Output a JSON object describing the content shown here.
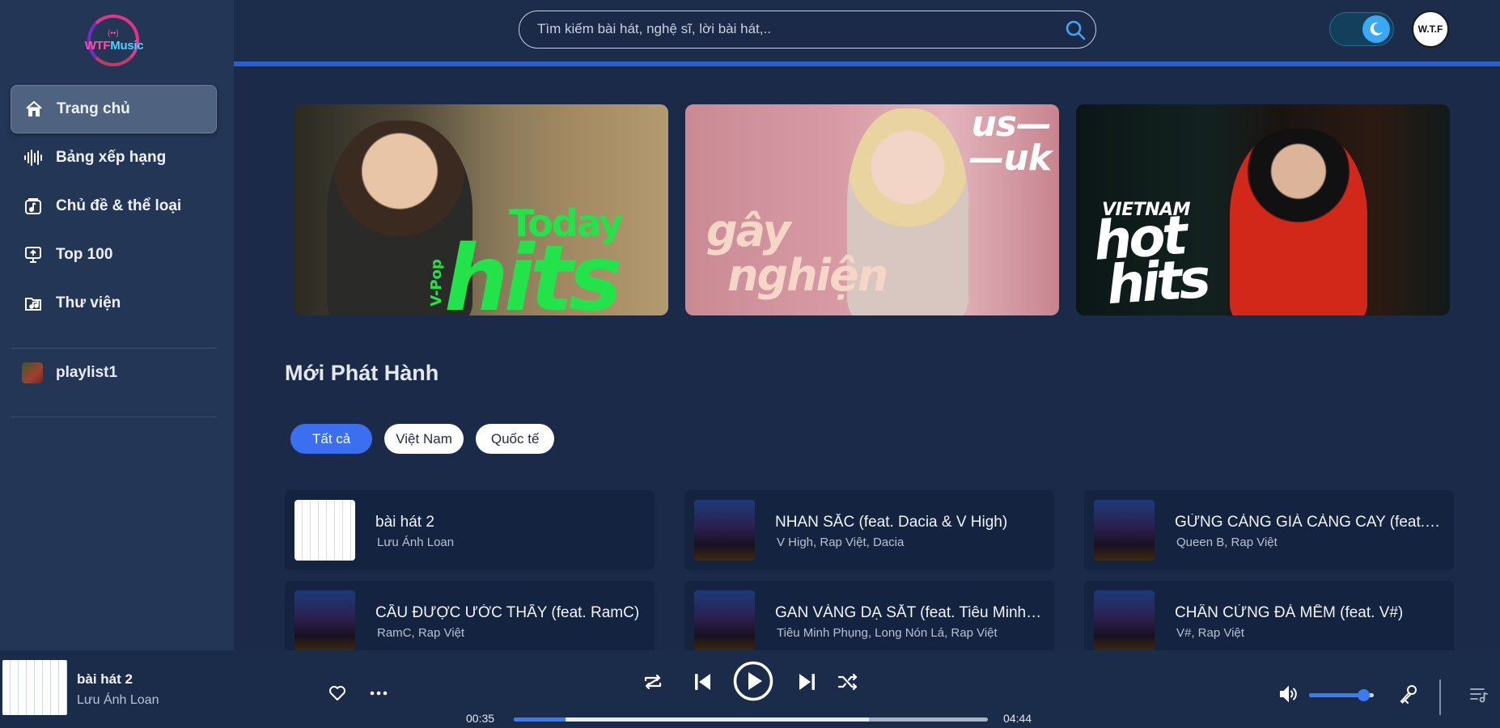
{
  "app": {
    "logo_part1": "WTF",
    "logo_part2": "Music"
  },
  "sidebar": {
    "items": [
      {
        "label": "Trang chủ",
        "icon": "home-icon",
        "active": true
      },
      {
        "label": "Bảng xếp hạng",
        "icon": "waveform-icon"
      },
      {
        "label": "Chủ đề & thể loại",
        "icon": "music-note-box-icon"
      },
      {
        "label": "Top 100",
        "icon": "podium-icon"
      },
      {
        "label": "Thư viện",
        "icon": "music-folder-icon"
      }
    ],
    "playlist": {
      "label": "playlist1"
    }
  },
  "header": {
    "search_placeholder": "Tìm kiếm bài hát, nghệ sĩ, lời bài hát,..",
    "avatar_text": "W.T.F"
  },
  "banners": [
    {
      "v_pop": "V-Pop",
      "today": "Today",
      "hits": "hits"
    },
    {
      "us": "us—",
      "uk": "—uk",
      "line1": "gây",
      "line2": "nghiện"
    },
    {
      "vietnam": "VIETNAM",
      "hot": "hot",
      "hits": "hits"
    }
  ],
  "section": {
    "title": "Mới Phát Hành",
    "filters": [
      "Tất cả",
      "Việt Nam",
      "Quốc tế"
    ]
  },
  "songs": [
    {
      "title": "bài hát 2",
      "artist": "Lưu Ánh Loan"
    },
    {
      "title": "NHAN SẮC (feat. Dacia & V High)",
      "artist": "V High, Rap Việt, Dacia"
    },
    {
      "title": "GỪNG CÀNG GIÀ CÀNG CAY (feat. ...",
      "artist": "Queen B, Rap Việt"
    },
    {
      "title": "CẦU ĐƯỢC ƯỚC THẤY (feat. RamC)",
      "artist": "RamC, Rap Việt"
    },
    {
      "title": "GAN VÀNG DẠ SẮT (feat. Tiêu Minh Phụng)",
      "artist": "Tiêu Minh Phụng, Long Nón Lá, Rap Việt"
    },
    {
      "title": "CHÂN CỨNG ĐÁ MỀM (feat. V#)",
      "artist": "V#, Rap Việt"
    }
  ],
  "player": {
    "title": "bài hát 2",
    "artist": "Lưu Ánh Loan",
    "current_time": "00:35",
    "total_time": "04:44",
    "progress": 0.11,
    "buffered": 0.75,
    "volume": 0.8,
    "accent_color": "#3c7cf0"
  }
}
